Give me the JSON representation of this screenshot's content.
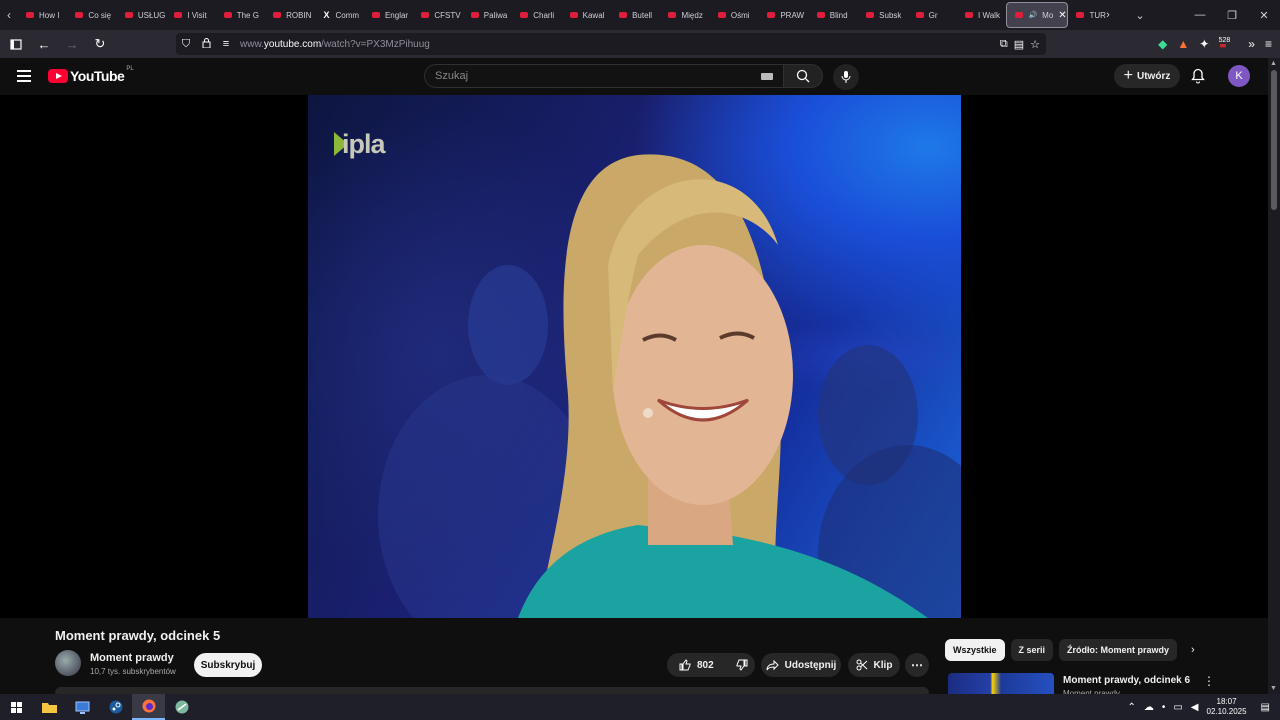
{
  "browser": {
    "tabs": [
      {
        "label": "How I",
        "icon": "youtube-icon"
      },
      {
        "label": "Co się",
        "icon": "youtube-icon"
      },
      {
        "label": "USŁUG",
        "icon": "youtube-icon"
      },
      {
        "label": "I Visit",
        "icon": "youtube-icon"
      },
      {
        "label": "The G",
        "icon": "youtube-icon"
      },
      {
        "label": "ROBIN",
        "icon": "youtube-icon"
      },
      {
        "label": "Comm",
        "icon": "x-icon"
      },
      {
        "label": "Englar",
        "icon": "youtube-icon"
      },
      {
        "label": "CFSTV",
        "icon": "youtube-icon"
      },
      {
        "label": "Paliwa",
        "icon": "youtube-icon"
      },
      {
        "label": "Charli",
        "icon": "youtube-icon"
      },
      {
        "label": "Kawal",
        "icon": "youtube-icon"
      },
      {
        "label": "Butell",
        "icon": "youtube-icon"
      },
      {
        "label": "Międz",
        "icon": "youtube-icon"
      },
      {
        "label": "Ośmi",
        "icon": "youtube-icon"
      },
      {
        "label": "PRAW",
        "icon": "youtube-icon"
      },
      {
        "label": "Blind",
        "icon": "youtube-icon"
      },
      {
        "label": "Subsk",
        "icon": "youtube-icon"
      },
      {
        "label": "Gr",
        "icon": "youtube-icon"
      },
      {
        "label": "I Walk",
        "icon": "youtube-icon"
      },
      {
        "label": "Mo",
        "icon": "youtube-icon",
        "active": true
      },
      {
        "label": "TUR",
        "icon": "youtube-icon"
      }
    ],
    "url_prefix": "www.",
    "url_domain": "youtube.com",
    "url_path": "/watch?v=PX3MzPihuug",
    "extension_badge": "528"
  },
  "youtube": {
    "logo_text": "YouTube",
    "region": "PL",
    "search_placeholder": "Szukaj",
    "create_label": "Utwórz",
    "avatar_letter": "K",
    "accent": "#ff0033"
  },
  "video": {
    "watermark": "ipla",
    "title": "Moment prawdy, odcinek 5",
    "channel_name": "Moment prawdy",
    "channel_subs": "10,7 tys. subskrybentów",
    "subscribe_label": "Subskrybuj",
    "likes": "802",
    "share_label": "Udostępnij",
    "clip_label": "Klip"
  },
  "sidebar": {
    "chips": [
      "Wszystkie",
      "Z serii",
      "Źródło: Moment prawdy"
    ],
    "recommended": {
      "title": "Moment prawdy, odcinek 6",
      "channel": "Moment prawdy"
    }
  },
  "taskbar": {
    "time": "18:07",
    "date": "02.10.2025"
  }
}
